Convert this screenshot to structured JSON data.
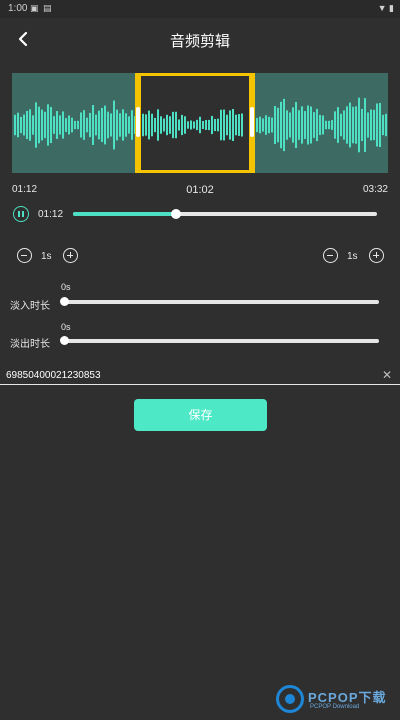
{
  "status_bar": {
    "time": "1:00",
    "icons_left": [
      "sd-card-icon",
      "notification-icon"
    ],
    "icons_right": [
      "wifi-icon",
      "battery-icon"
    ]
  },
  "header": {
    "title": "音频剪辑",
    "back_icon": "back-arrow-icon"
  },
  "waveform": {
    "accent_color": "#4de0c2",
    "selection_color": "#f5c400"
  },
  "timeline": {
    "start": "01:12",
    "selected_duration": "01:02",
    "end": "03:32"
  },
  "playback": {
    "state_icon": "pause-icon",
    "current_time": "01:12",
    "progress": 0.34
  },
  "step_controls": {
    "left_value": "1s",
    "right_value": "1s"
  },
  "fade_in": {
    "label": "淡入时长",
    "value": "0s",
    "level": 0
  },
  "fade_out": {
    "label": "淡出时长",
    "value": "0s",
    "level": 0
  },
  "filename": {
    "value": "69850400021230853"
  },
  "save_button": {
    "label": "保存",
    "color": "#4de8c6"
  },
  "watermark": {
    "text": "PCPOP下载",
    "subtitle": "PCPOP Download"
  }
}
